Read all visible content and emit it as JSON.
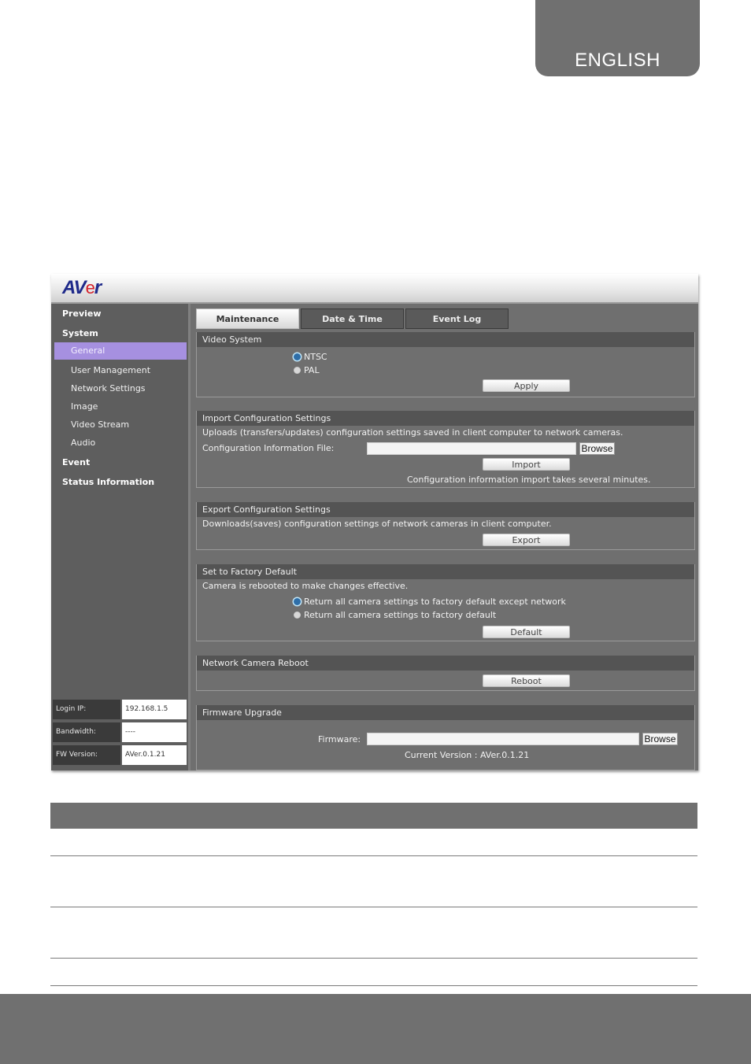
{
  "page": {
    "language_tab": "ENGLISH"
  },
  "app": {
    "logo": {
      "prefix": "AV",
      "accent": "e",
      "suffix": "r"
    },
    "brand_colors": {
      "logo_blue": "#1f2a8a",
      "logo_red": "#d5202a",
      "selected_nav": "#a690e0"
    }
  },
  "sidebar": {
    "items": [
      {
        "label": "Preview",
        "level": "main"
      },
      {
        "label": "System",
        "level": "main"
      },
      {
        "label": "General",
        "level": "sub",
        "selected": true
      },
      {
        "label": "User Management",
        "level": "sub"
      },
      {
        "label": "Network Settings",
        "level": "sub"
      },
      {
        "label": "Image",
        "level": "sub"
      },
      {
        "label": "Video Stream",
        "level": "sub"
      },
      {
        "label": "Audio",
        "level": "sub"
      },
      {
        "label": "Event",
        "level": "main"
      },
      {
        "label": "Status Information",
        "level": "main"
      }
    ],
    "info": [
      {
        "label": "Login IP:",
        "value": "192.168.1.5"
      },
      {
        "label": "Bandwidth:",
        "value": "----"
      },
      {
        "label": "FW Version:",
        "value": "AVer.0.1.21"
      }
    ]
  },
  "tabs": [
    {
      "label": "Maintenance",
      "active": true
    },
    {
      "label": "Date & Time",
      "active": false
    },
    {
      "label": "Event Log",
      "active": false
    }
  ],
  "video_system": {
    "title": "Video System",
    "options": [
      {
        "label": "NTSC",
        "selected": true
      },
      {
        "label": "PAL",
        "selected": false
      }
    ],
    "apply_label": "Apply"
  },
  "import_config": {
    "title": "Import Configuration Settings",
    "description": "Uploads (transfers/updates) configuration settings saved in client computer to network cameras.",
    "file_label": "Configuration Information File:",
    "file_value": "",
    "browse_label": "Browse",
    "import_label": "Import",
    "note": "Configuration information import takes several minutes."
  },
  "export_config": {
    "title": "Export Configuration Settings",
    "description": "Downloads(saves) configuration settings of network cameras in client computer.",
    "export_label": "Export"
  },
  "factory_default": {
    "title": "Set to Factory Default",
    "description": "Camera is rebooted to make changes effective.",
    "options": [
      {
        "label": "Return all camera settings to factory default except network",
        "selected": true
      },
      {
        "label": "Return all camera settings to factory default",
        "selected": false
      }
    ],
    "default_label": "Default"
  },
  "reboot": {
    "title": "Network Camera Reboot",
    "reboot_label": "Reboot"
  },
  "firmware": {
    "title": "Firmware Upgrade",
    "file_label": "Firmware:",
    "file_value": "",
    "browse_label": "Browse",
    "current_version": "Current Version : AVer.0.1.21"
  }
}
